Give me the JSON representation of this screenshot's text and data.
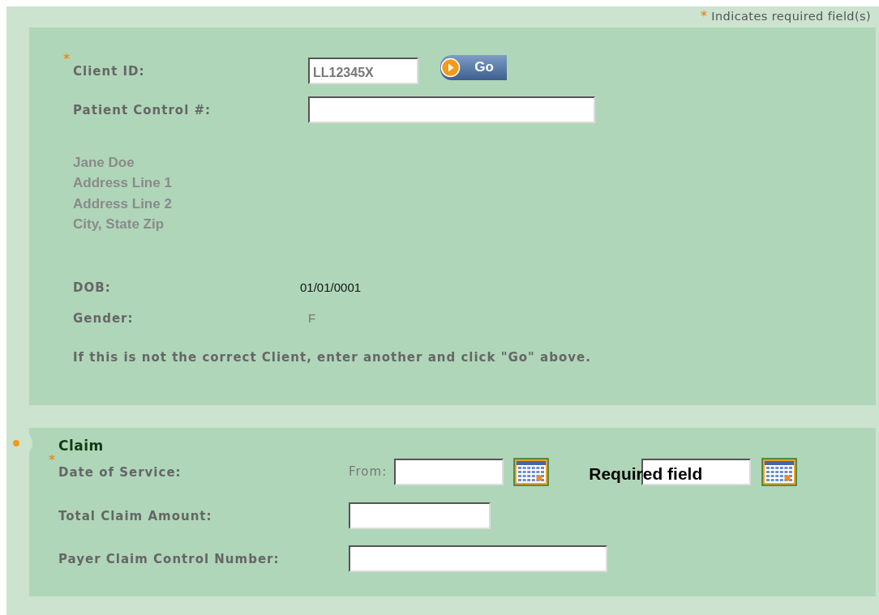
{
  "required_note": {
    "marker": "*",
    "text": "Indicates required field(s)"
  },
  "client": {
    "client_id": {
      "marker": "*",
      "label": "Client ID:",
      "value": "LL12345X"
    },
    "go_button": "Go",
    "patient_control": {
      "label": "Patient Control #:"
    },
    "address": [
      "Jane Doe",
      "Address Line 1",
      "Address Line 2",
      "City, State Zip"
    ],
    "details": [
      {
        "label": "DOB:",
        "value": "01/01/0001",
        "kind": "date"
      },
      {
        "label": "Gender:",
        "value": "F",
        "kind": "code"
      }
    ],
    "hint": "If this is not the correct Client, enter another and click \"Go\" above."
  },
  "claim": {
    "title": "Claim",
    "date_of_service": {
      "marker": "*",
      "label": "Date of Service:",
      "from_label": "From:"
    },
    "callout": "Required field",
    "fields": [
      {
        "label": "Total Claim Amount:"
      },
      {
        "label": "Payer Claim Control Number:"
      }
    ]
  }
}
